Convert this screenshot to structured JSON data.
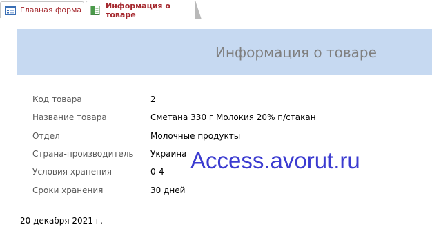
{
  "tabs": [
    {
      "label": "Главная форма",
      "icon": "form-icon",
      "active": false
    },
    {
      "label": "Информация о товаре",
      "icon": "report-icon",
      "active": true
    }
  ],
  "form": {
    "title": "Информация о товаре",
    "fields": [
      {
        "label": "Код товара",
        "value": "2"
      },
      {
        "label": "Название товара",
        "value": "Сметана 330 г Молокия 20% п/стакан"
      },
      {
        "label": "Отдел",
        "value": "Молочные продукты"
      },
      {
        "label": "Страна-производитель",
        "value": "Украина"
      },
      {
        "label": "Условия хранения",
        "value": "0-4"
      },
      {
        "label": "Сроки хранения",
        "value": "30 дней"
      }
    ],
    "date": "20 декабря 2021 г."
  },
  "watermark": "Access.avorut.ru",
  "colors": {
    "header_band": "#c6d9f1",
    "tab_text": "#a4262c",
    "title_text": "#7f7f7f",
    "watermark": "#3b3bd0"
  }
}
